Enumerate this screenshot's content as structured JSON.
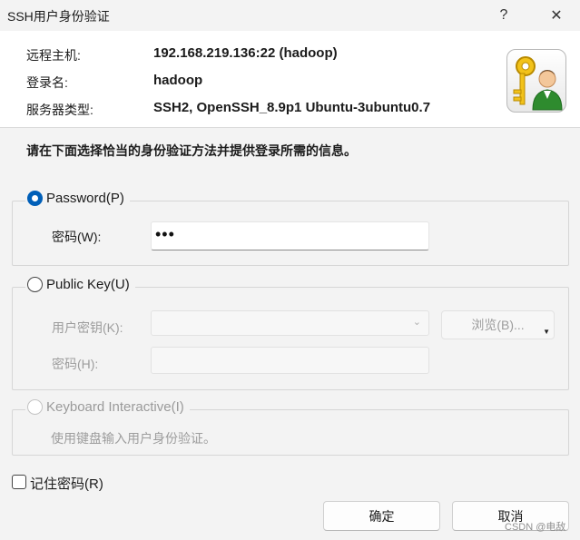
{
  "window": {
    "title": "SSH用户身份验证",
    "help_glyph": "?",
    "close_glyph": "✕"
  },
  "info": {
    "host_label": "远程主机:",
    "host_value": "192.168.219.136:22 (hadoop)",
    "login_label": "登录名:",
    "login_value": "hadoop",
    "server_label": "服务器类型:",
    "server_value": "SSH2, OpenSSH_8.9p1 Ubuntu-3ubuntu0.7",
    "icon": "key-user-icon"
  },
  "instruction": "请在下面选择恰当的身份验证方法并提供登录所需的信息。",
  "password_group": {
    "option_label": "Password(P)",
    "selected": true,
    "password_label": "密码(W):",
    "password_value": "•••"
  },
  "publickey_group": {
    "option_label": "Public Key(U)",
    "selected": false,
    "user_key_label": "用户密钥(K):",
    "user_key_value": "",
    "browse_label": "浏览(B)...",
    "passphrase_label": "密码(H):",
    "passphrase_value": ""
  },
  "keyboard_group": {
    "option_label": "Keyboard Interactive(I)",
    "selected": false,
    "hint": "使用键盘输入用户身份验证。"
  },
  "remember": {
    "label": "记住密码(R)",
    "checked": false
  },
  "buttons": {
    "ok": "确定",
    "cancel": "取消"
  },
  "watermark": "CSDN @电敌",
  "colors": {
    "accent": "#005fb8",
    "window_bg": "#f3f3f3",
    "panel_bg": "#ffffff",
    "disabled_text": "#9d9d9d"
  }
}
